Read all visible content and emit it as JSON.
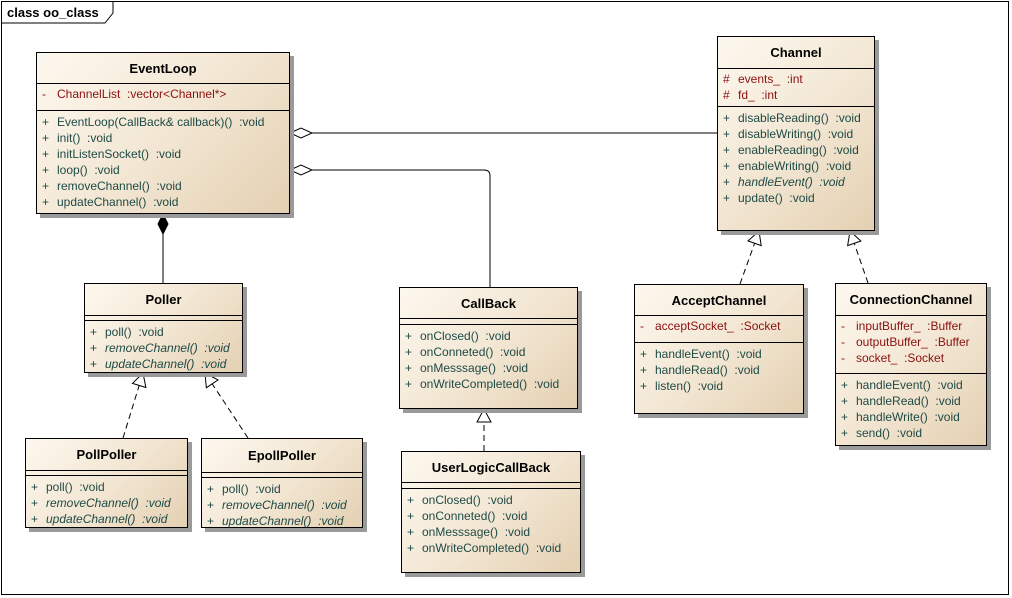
{
  "frame": {
    "title": "class oo_class"
  },
  "colors": {
    "attribute": "#8b1010",
    "operation": "#1e4a46",
    "fill_light": "#fdf8ef",
    "fill_dark": "#e4d0b2"
  },
  "classes": [
    {
      "id": "eventloop",
      "name": "EventLoop",
      "attributes": [
        {
          "vis": "-",
          "text": "ChannelList  :vector<Channel*>"
        }
      ],
      "operations": [
        {
          "vis": "+",
          "text": "EventLoop(CallBack& callback)()  :void"
        },
        {
          "vis": "+",
          "text": "init()  :void"
        },
        {
          "vis": "+",
          "text": "initListenSocket()  :void"
        },
        {
          "vis": "+",
          "text": "loop()  :void"
        },
        {
          "vis": "+",
          "text": "removeChannel()  :void"
        },
        {
          "vis": "+",
          "text": "updateChannel()  :void"
        }
      ]
    },
    {
      "id": "channel",
      "name": "Channel",
      "attributes": [
        {
          "vis": "#",
          "text": "events_  :int"
        },
        {
          "vis": "#",
          "text": "fd_  :int"
        }
      ],
      "operations": [
        {
          "vis": "+",
          "text": "disableReading()  :void"
        },
        {
          "vis": "+",
          "text": "disableWriting()  :void"
        },
        {
          "vis": "+",
          "text": "enableReading()  :void"
        },
        {
          "vis": "+",
          "text": "enableWriting()  :void"
        },
        {
          "vis": "+",
          "text": "handleEvent()  :void",
          "italic": true
        },
        {
          "vis": "+",
          "text": "update()  :void"
        }
      ]
    },
    {
      "id": "poller",
      "name": "Poller",
      "attributes": [],
      "operations": [
        {
          "vis": "+",
          "text": "poll()  :void"
        },
        {
          "vis": "+",
          "text": "removeChannel()  :void",
          "italic": true
        },
        {
          "vis": "+",
          "text": "updateChannel()  :void",
          "italic": true
        }
      ]
    },
    {
      "id": "pollpoller",
      "name": "PollPoller",
      "attributes": [],
      "operations": [
        {
          "vis": "+",
          "text": "poll()  :void"
        },
        {
          "vis": "+",
          "text": "removeChannel()  :void",
          "italic": true
        },
        {
          "vis": "+",
          "text": "updateChannel()  :void",
          "italic": true
        }
      ]
    },
    {
      "id": "epollpoller",
      "name": "EpollPoller",
      "attributes": [],
      "operations": [
        {
          "vis": "+",
          "text": "poll()  :void"
        },
        {
          "vis": "+",
          "text": "removeChannel()  :void",
          "italic": true
        },
        {
          "vis": "+",
          "text": "updateChannel()  :void",
          "italic": true
        }
      ]
    },
    {
      "id": "callback",
      "name": "CallBack",
      "attributes": [],
      "operations": [
        {
          "vis": "+",
          "text": "onClosed()  :void"
        },
        {
          "vis": "+",
          "text": "onConneted()  :void"
        },
        {
          "vis": "+",
          "text": "onMesssage()  :void"
        },
        {
          "vis": "+",
          "text": "onWriteCompleted()  :void"
        }
      ]
    },
    {
      "id": "userlogiccallback",
      "name": "UserLogicCallBack",
      "attributes": [],
      "operations": [
        {
          "vis": "+",
          "text": "onClosed()  :void"
        },
        {
          "vis": "+",
          "text": "onConneted()  :void"
        },
        {
          "vis": "+",
          "text": "onMesssage()  :void"
        },
        {
          "vis": "+",
          "text": "onWriteCompleted()  :void"
        }
      ]
    },
    {
      "id": "acceptchannel",
      "name": "AcceptChannel",
      "attributes": [
        {
          "vis": "-",
          "text": "acceptSocket_  :Socket"
        }
      ],
      "operations": [
        {
          "vis": "+",
          "text": "handleEvent()  :void"
        },
        {
          "vis": "+",
          "text": "handleRead()  :void"
        },
        {
          "vis": "+",
          "text": "listen()  :void"
        }
      ]
    },
    {
      "id": "connectionchannel",
      "name": "ConnectionChannel",
      "attributes": [
        {
          "vis": "-",
          "text": "inputBuffer_  :Buffer"
        },
        {
          "vis": "-",
          "text": "outputBuffer_  :Buffer"
        },
        {
          "vis": "-",
          "text": "socket_  :Socket"
        }
      ],
      "operations": [
        {
          "vis": "+",
          "text": "handleEvent()  :void"
        },
        {
          "vis": "+",
          "text": "handleRead()  :void"
        },
        {
          "vis": "+",
          "text": "handleWrite()  :void"
        },
        {
          "vis": "+",
          "text": "send()  :void"
        }
      ]
    }
  ],
  "relations": [
    {
      "type": "aggregation",
      "from": "eventloop",
      "to": "channel"
    },
    {
      "type": "aggregation",
      "from": "eventloop",
      "to": "callback"
    },
    {
      "type": "composition",
      "from": "eventloop",
      "to": "poller"
    },
    {
      "type": "realization",
      "from": "pollpoller",
      "to": "poller"
    },
    {
      "type": "realization",
      "from": "epollpoller",
      "to": "poller"
    },
    {
      "type": "realization",
      "from": "userlogiccallback",
      "to": "callback"
    },
    {
      "type": "realization",
      "from": "acceptchannel",
      "to": "channel"
    },
    {
      "type": "realization",
      "from": "connectionchannel",
      "to": "channel"
    }
  ]
}
